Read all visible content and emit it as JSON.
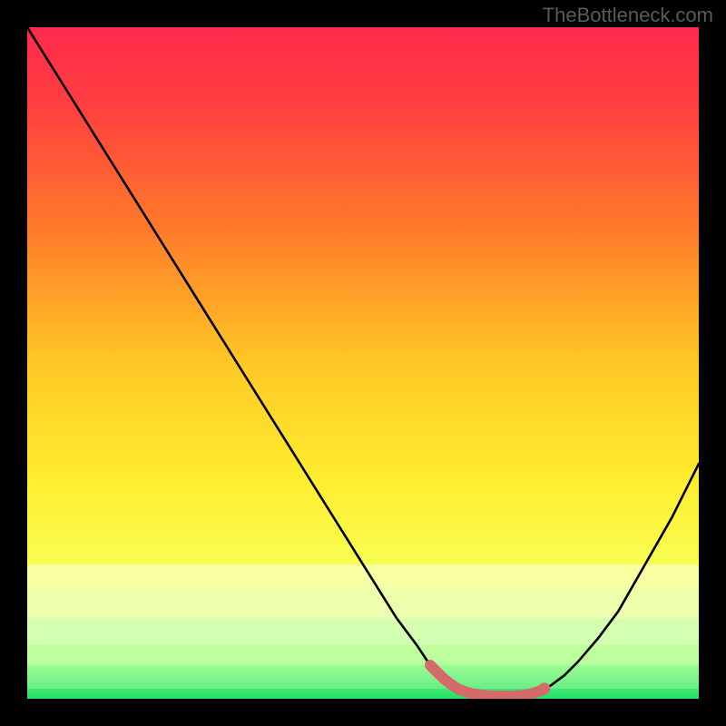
{
  "watermark": "TheBottleneck.com",
  "chart_data": {
    "type": "line",
    "title": "",
    "xlabel": "",
    "ylabel": "",
    "xlim": [
      0,
      100
    ],
    "ylim": [
      0,
      100
    ],
    "series": [
      {
        "name": "bottleneck-curve",
        "x": [
          0,
          5,
          10,
          15,
          20,
          25,
          30,
          35,
          40,
          45,
          50,
          55,
          58,
          60,
          62,
          64,
          66,
          68,
          70,
          72,
          74,
          76,
          78,
          80,
          82,
          85,
          88,
          92,
          96,
          100
        ],
        "y": [
          100,
          92,
          84,
          76,
          68,
          60,
          52,
          44,
          36,
          28,
          20,
          12,
          8,
          5,
          3,
          1.5,
          0.8,
          0.5,
          0.4,
          0.4,
          0.5,
          1,
          2,
          3.5,
          5.5,
          9,
          13,
          20,
          27,
          35
        ]
      }
    ],
    "highlight": {
      "name": "optimal-range",
      "x_start": 60,
      "x_end": 77
    },
    "gradient_stops": [
      {
        "offset": 0.0,
        "color": "#ff2a4d"
      },
      {
        "offset": 0.12,
        "color": "#ff4040"
      },
      {
        "offset": 0.3,
        "color": "#ff7a2a"
      },
      {
        "offset": 0.5,
        "color": "#ffc825"
      },
      {
        "offset": 0.68,
        "color": "#ffee30"
      },
      {
        "offset": 0.8,
        "color": "#f7ff52"
      },
      {
        "offset": 0.88,
        "color": "#d8ff70"
      },
      {
        "offset": 0.94,
        "color": "#9fff88"
      },
      {
        "offset": 1.0,
        "color": "#22e06a"
      }
    ]
  }
}
